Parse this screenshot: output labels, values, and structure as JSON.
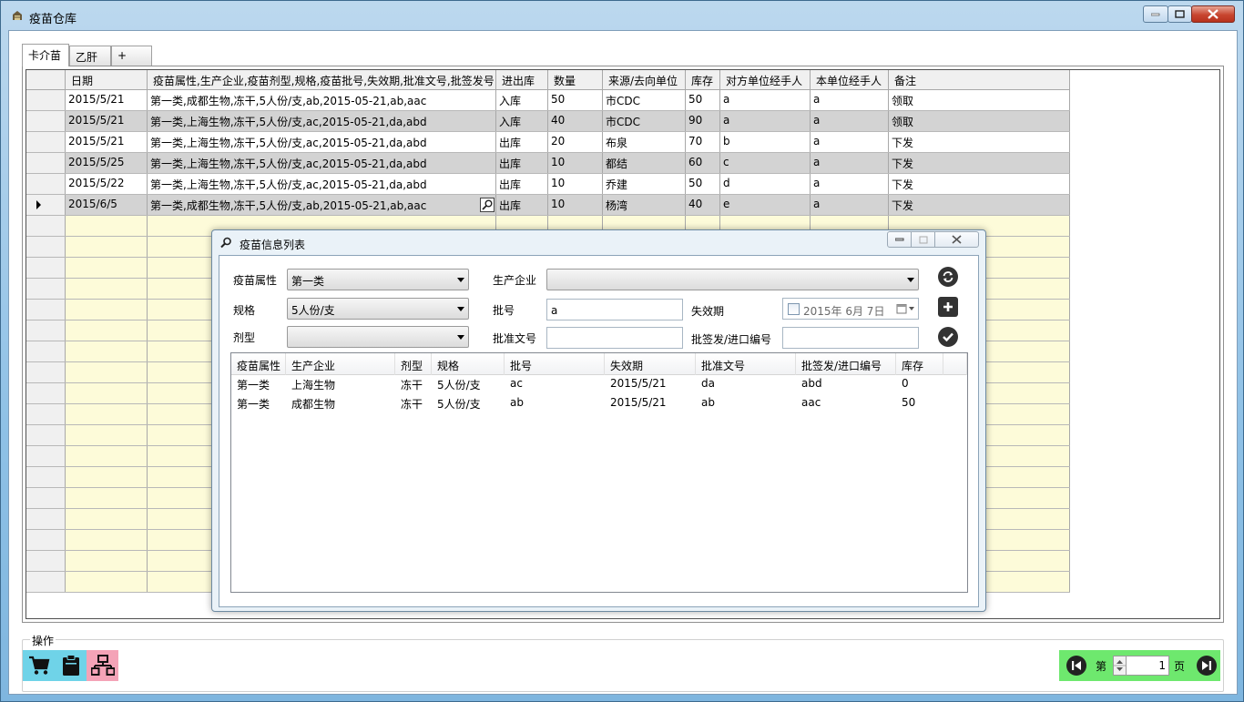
{
  "window": {
    "title": "疫苗仓库",
    "colors": {
      "frame": "#8fc1e6",
      "close": "#c7452f"
    }
  },
  "tabs": [
    {
      "label": "卡介苗",
      "active": true
    },
    {
      "label": "乙肝",
      "active": false
    },
    {
      "label": "+",
      "active": false
    }
  ],
  "main_grid": {
    "columns": [
      "日期",
      "疫苗属性,生产企业,疫苗剂型,规格,疫苗批号,失效期,批准文号,批签发号",
      "进出库",
      "数量",
      "来源/去向单位",
      "库存",
      "对方单位经手人",
      "本单位经手人",
      "备注"
    ],
    "rows": [
      [
        "2015/5/21",
        "第一类,成都生物,冻干,5人份/支,ab,2015-05-21,ab,aac",
        "入库",
        "50",
        "市CDC",
        "50",
        "a",
        "a",
        "领取"
      ],
      [
        "2015/5/21",
        "第一类,上海生物,冻干,5人份/支,ac,2015-05-21,da,abd",
        "入库",
        "40",
        "市CDC",
        "90",
        "a",
        "a",
        "领取"
      ],
      [
        "2015/5/21",
        "第一类,上海生物,冻干,5人份/支,ac,2015-05-21,da,abd",
        "出库",
        "20",
        "布泉",
        "70",
        "b",
        "a",
        "下发"
      ],
      [
        "2015/5/25",
        "第一类,上海生物,冻干,5人份/支,ac,2015-05-21,da,abd",
        "出库",
        "10",
        "都结",
        "60",
        "c",
        "a",
        "下发"
      ],
      [
        "2015/5/22",
        "第一类,上海生物,冻干,5人份/支,ac,2015-05-21,da,abd",
        "出库",
        "10",
        "乔建",
        "50",
        "d",
        "a",
        "下发"
      ],
      [
        "2015/6/5",
        "第一类,成都生物,冻干,5人份/支,ab,2015-05-21,ab,aac",
        "出库",
        "10",
        "杨湾",
        "40",
        "e",
        "a",
        "下发"
      ]
    ],
    "current_row": 5,
    "empty_rows": 18,
    "colors": {
      "alt_row": "#d3d3d3",
      "empty_row": "#fdfbd9"
    }
  },
  "dialog": {
    "title": "疫苗信息列表",
    "labels": {
      "attr": "疫苗属性",
      "maker": "生产企业",
      "spec": "规格",
      "batch": "批号",
      "expiry": "失效期",
      "form": "剂型",
      "approval": "批准文号",
      "lot_release": "批签发/进口编号"
    },
    "values": {
      "attr": "第一类",
      "maker": "",
      "spec": "5人份/支",
      "batch": "a",
      "expiry_date": "2015年  6月  7日",
      "form": "",
      "approval": "",
      "lot_release": ""
    },
    "buttons": [
      "refresh-icon",
      "add-icon",
      "confirm-icon"
    ],
    "list": {
      "columns": [
        "疫苗属性",
        "生产企业",
        "剂型",
        "规格",
        "批号",
        "失效期",
        "批准文号",
        "批签发/进口编号",
        "库存"
      ],
      "rows": [
        [
          "第一类",
          "上海生物",
          "冻干",
          "5人份/支",
          "ac",
          "2015/5/21",
          "da",
          "abd",
          "0"
        ],
        [
          "第一类",
          "成都生物",
          "冻干",
          "5人份/支",
          "ab",
          "2015/5/21",
          "ab",
          "aac",
          "50"
        ]
      ]
    }
  },
  "ops": {
    "group_label": "操作",
    "buttons": [
      "cart-icon",
      "clipboard-icon",
      "org-chart-icon"
    ],
    "colors": {
      "cyan": "#6fd3e8",
      "pink": "#f4a3b7",
      "pager": "#6ee86e"
    }
  },
  "pager": {
    "prefix": "第",
    "page": "1",
    "suffix": "页"
  }
}
